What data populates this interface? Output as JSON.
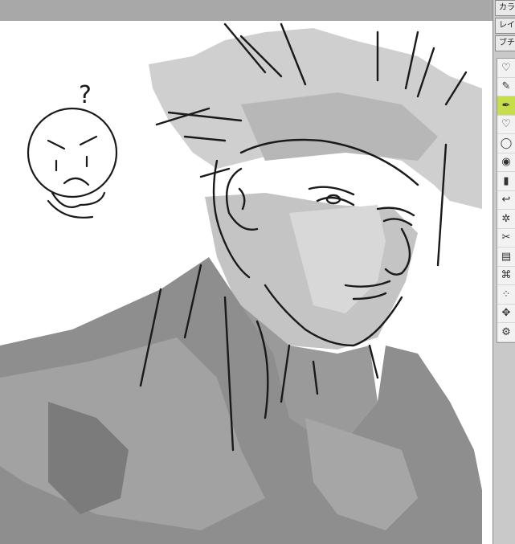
{
  "panel": {
    "tabs": [
      {
        "label": "カラ"
      },
      {
        "label": "レイ"
      },
      {
        "label": "ブチ"
      }
    ]
  },
  "tools": [
    {
      "name": "heart",
      "glyph": "♡",
      "active": false
    },
    {
      "name": "eyedropper",
      "glyph": "✎",
      "active": false
    },
    {
      "name": "pen",
      "glyph": "✒",
      "active": true
    },
    {
      "name": "heart-2",
      "glyph": "♡",
      "active": false
    },
    {
      "name": "lasso",
      "glyph": "◯",
      "active": false
    },
    {
      "name": "fill",
      "glyph": "◉",
      "active": false
    },
    {
      "name": "gradient",
      "glyph": "▮",
      "active": false
    },
    {
      "name": "undo",
      "glyph": "↩",
      "active": false
    },
    {
      "name": "sparkle",
      "glyph": "✲",
      "active": false
    },
    {
      "name": "scissors",
      "glyph": "✂",
      "active": false
    },
    {
      "name": "clipboard",
      "glyph": "▤",
      "active": false
    },
    {
      "name": "transform",
      "glyph": "⌘",
      "active": false
    },
    {
      "name": "select-dots",
      "glyph": "⁘",
      "active": false
    },
    {
      "name": "move",
      "glyph": "✥",
      "active": false
    },
    {
      "name": "gear",
      "glyph": "⚙",
      "active": false
    }
  ],
  "canvas": {
    "doodle_text": "?"
  }
}
